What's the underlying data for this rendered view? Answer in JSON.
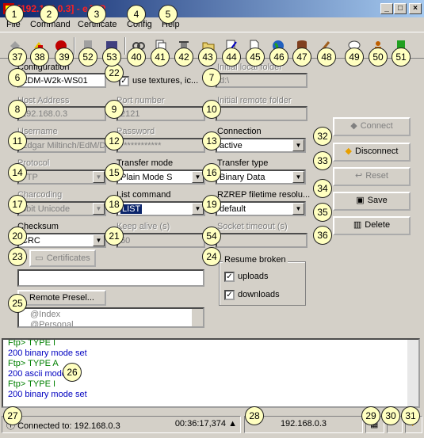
{
  "window": {
    "title": "[192.168.0.3] - eJSP",
    "minimize": "_",
    "maximize": "□",
    "close": "×"
  },
  "menu": {
    "file": "File",
    "command": "Command",
    "certificate": "Certificate",
    "config": "Config",
    "help": "Help"
  },
  "form": {
    "configuration_label": "Configuration",
    "configuration_value": "EDM-W2k-WS01",
    "use_textures_label": "use textures, ic...",
    "initial_local_label": "Initial local folder",
    "initial_local_value": "d:\\",
    "host_label": "Host Address",
    "host_value": "192.168.0.3",
    "port_label": "Port number",
    "port_value": "2121",
    "initial_remote_label": "Initial remote folder",
    "initial_remote_value": "",
    "username_label": "Username",
    "username_value": "Edgar Miltinch/EdM/DE",
    "password_label": "Password",
    "password_value": "************",
    "connection_label": "Connection",
    "connection_value": "active",
    "protocol_label": "Protocol",
    "protocol_value": "FTP",
    "transfer_mode_label": "Transfer mode",
    "transfer_mode_value": "Plain Mode S",
    "transfer_type_label": "Transfer type",
    "transfer_type_value": "Binary Data",
    "charcoding_label": "Charcoding",
    "charcoding_value": "8bit Unicode",
    "list_command_label": "List command",
    "list_command_value": "LIST",
    "rzrep_label": "RZREP filetime resolu...",
    "rzrep_value": "default",
    "checksum_label": "Checksum",
    "checksum_value": "CRC",
    "keepalive_label": "Keep alive (s)",
    "keepalive_value": "60",
    "socket_timeout_label": "Socket timeout (s)",
    "socket_timeout_value": "",
    "certificates_button": "Certificates",
    "certificate_value": "",
    "resume_broken_label": "Resume broken",
    "uploads_label": "uploads",
    "downloads_label": "downloads",
    "remote_presel_button": "Remote Presel...",
    "presel_items": [
      "@Index",
      "@Personal"
    ]
  },
  "actions": {
    "connect": "Connect",
    "disconnect": "Disconnect",
    "reset": "Reset",
    "save": "Save",
    "delete": "Delete"
  },
  "log": [
    {
      "text": "Ftp> TYPE I",
      "kind": "cmd"
    },
    {
      "text": "200 binary mode set",
      "kind": "resp"
    },
    {
      "text": "Ftp> TYPE A",
      "kind": "cmd"
    },
    {
      "text": "200 ascii mode",
      "kind": "resp"
    },
    {
      "text": "Ftp> TYPE I",
      "kind": "cmd"
    },
    {
      "text": "200 binary mode set",
      "kind": "resp"
    }
  ],
  "status": {
    "connected": "Connected to: 192.168.0.3",
    "time": "00:36:17,374",
    "host": "192.168.0.3"
  },
  "badges": [
    "1",
    "2",
    "3",
    "4",
    "5",
    "6",
    "7",
    "8",
    "9",
    "10",
    "11",
    "12",
    "13",
    "14",
    "15",
    "16",
    "17",
    "18",
    "19",
    "20",
    "21",
    "22",
    "23",
    "24",
    "25",
    "26",
    "27",
    "28",
    "29",
    "30",
    "31",
    "32",
    "33",
    "34",
    "35",
    "36",
    "37",
    "38",
    "39",
    "40",
    "41",
    "42",
    "43",
    "44",
    "45",
    "46",
    "47",
    "48",
    "49",
    "50",
    "51",
    "52",
    "53",
    "54"
  ],
  "colors": {
    "cmd": "#008000",
    "resp": "#0000c0",
    "selection": "#0a246a"
  }
}
